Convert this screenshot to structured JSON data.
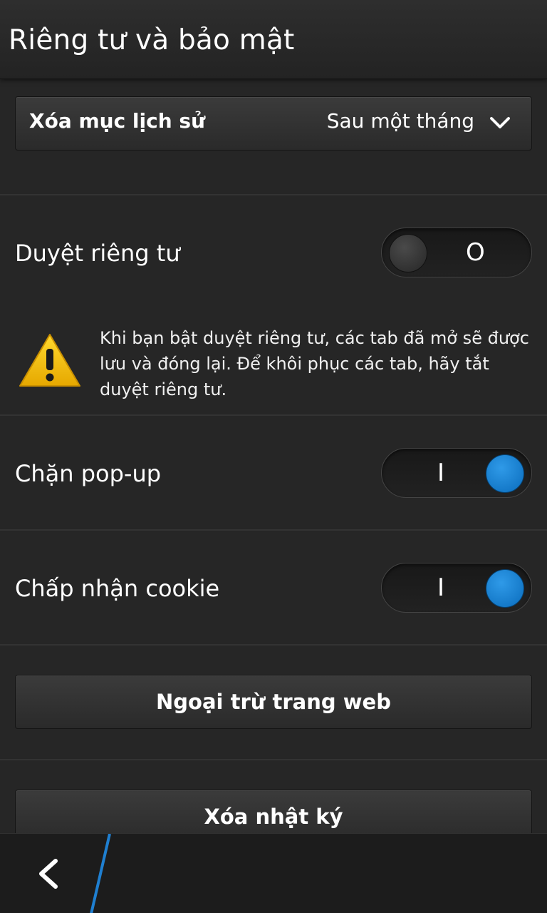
{
  "header": {
    "title": "Riêng tư và bảo mật"
  },
  "history": {
    "label": "Xóa mục lịch sử",
    "value": "Sau một tháng"
  },
  "private_browsing": {
    "label": "Duyệt riêng tư",
    "state_glyph": "O",
    "enabled": false
  },
  "warning": {
    "icon": "warning-triangle",
    "text": "Khi bạn bật duyệt riêng tư, các tab đã mở sẽ được lưu và đóng lại. Để khôi phục các tab, hãy tắt duyệt riêng tư."
  },
  "block_popups": {
    "label": "Chặn pop-up",
    "state_glyph": "I",
    "enabled": true
  },
  "accept_cookies": {
    "label": "Chấp nhận cookie",
    "state_glyph": "I",
    "enabled": true
  },
  "buttons": {
    "site_exceptions": "Ngoại trừ trang web",
    "clear_history": "Xóa nhật ký"
  },
  "colors": {
    "accent": "#0a6cbc",
    "background": "#262626",
    "warning": "#f5c400"
  }
}
